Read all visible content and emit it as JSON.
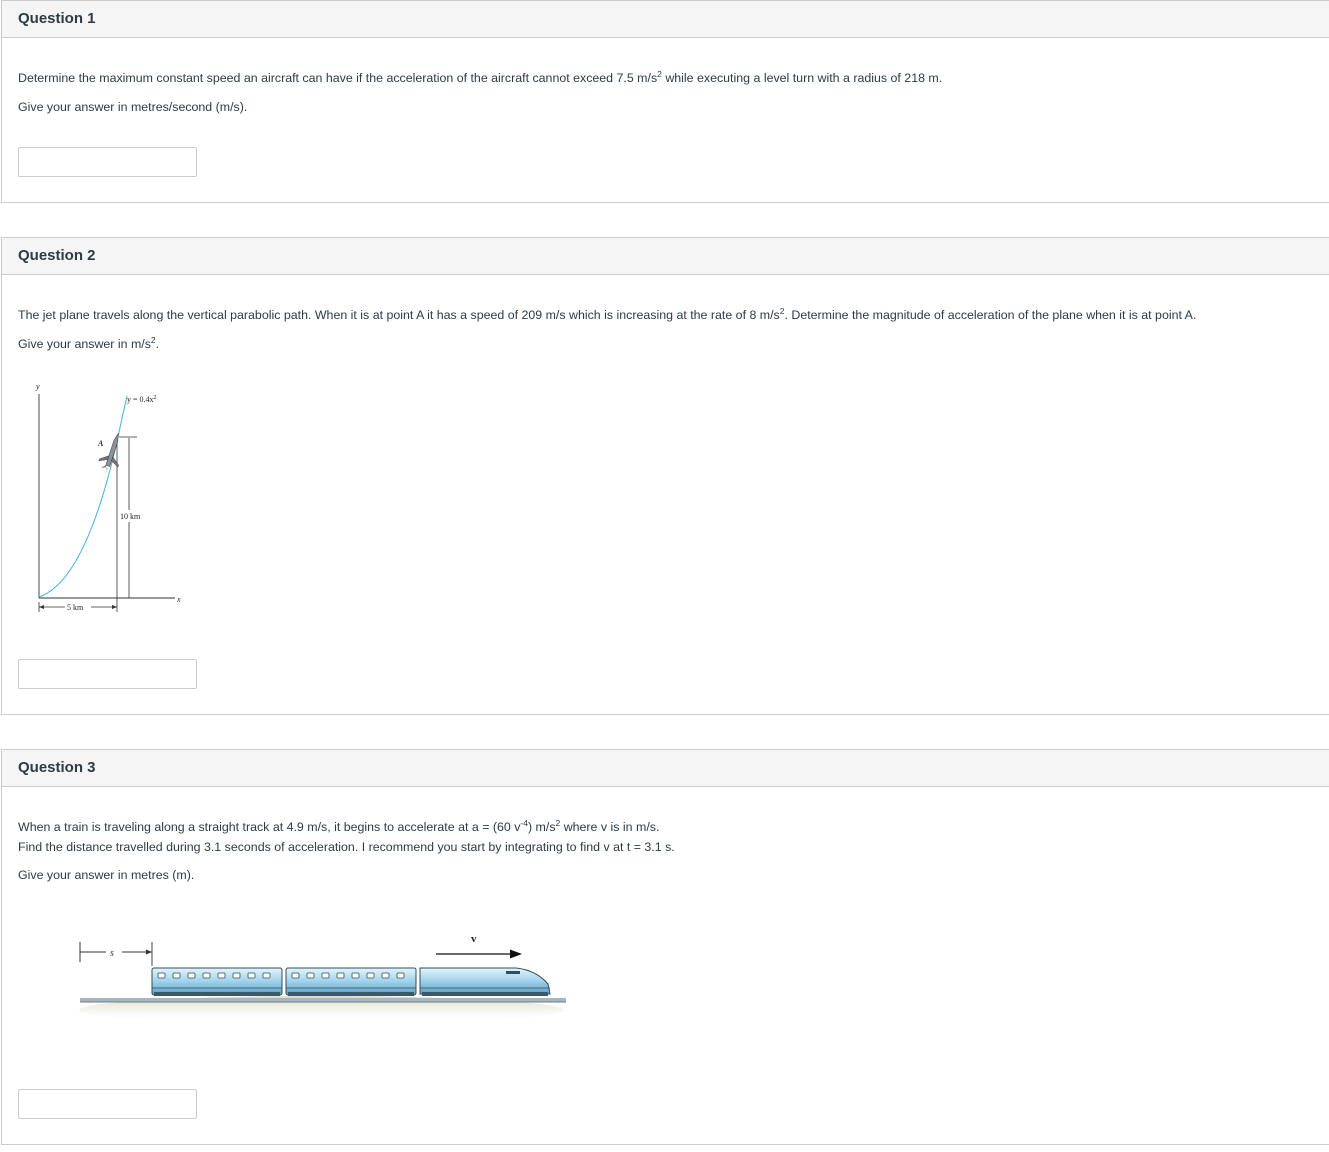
{
  "questions": [
    {
      "title": "Question 1",
      "body_pre": "Determine the maximum constant speed an aircraft can have if the acceleration of the aircraft cannot exceed 7.5 m/s",
      "body_sup": "2",
      "body_post": " while executing a level turn with a radius of 218 m.",
      "instruction": "Give your answer in metres/second (m/s).",
      "answer_value": ""
    },
    {
      "title": "Question 2",
      "body_pre": "The jet plane travels along the vertical parabolic path. When it is at point A it has a speed of 209 m/s which is increasing at the rate of 8 m/s",
      "body_sup": "2",
      "body_post": ". Determine the magnitude of acceleration of the plane when it is at point A.",
      "instruction_pre": "Give your answer in m/s",
      "instruction_sup": "2",
      "instruction_post": ".",
      "figure": {
        "y_axis_label": "y",
        "x_axis_label": "x",
        "equation": "y = 0.4x",
        "equation_sup": "2",
        "point_label": "A",
        "height_label": "10 km",
        "width_label": "5 km",
        "curve_color": "#3fb2de"
      },
      "answer_value": ""
    },
    {
      "title": "Question 3",
      "line1_pre": "When a train is traveling along a straight track at 4.9 m/s, it begins to accelerate at a = (60 v",
      "line1_sup1": "-4",
      "line1_mid": ") m/s",
      "line1_sup2": "2",
      "line1_post": " where v is in m/s.",
      "line2": "Find the distance travelled during 3.1 seconds of acceleration. I recommend you start by integrating to find v at t = 3.1 s.",
      "instruction": "Give your answer in metres (m).",
      "figure": {
        "s_label": "s",
        "v_label": "v",
        "train_color": "#9fd2ea"
      },
      "answer_value": ""
    }
  ]
}
